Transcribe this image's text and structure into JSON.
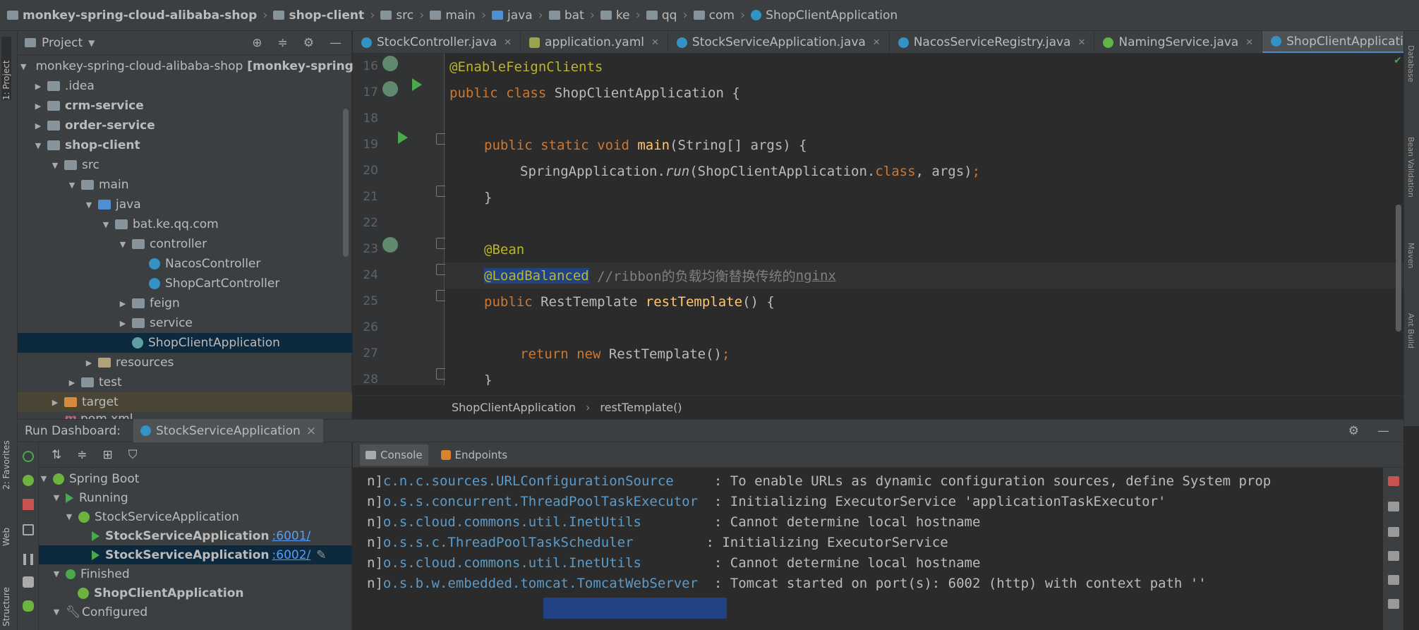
{
  "navbar": {
    "crumbs": [
      "monkey-spring-cloud-alibaba-shop",
      "shop-client",
      "src",
      "main",
      "java",
      "bat",
      "ke",
      "qq",
      "com",
      "ShopClientApplication"
    ]
  },
  "leftstrip": {
    "project": "1: Project",
    "favorites": "2: Favorites",
    "web": "Web",
    "structure": "Z: Structure"
  },
  "rightstrip": {
    "database": "Database",
    "bean": "Bean Validation",
    "maven": "Maven",
    "ant": "Ant Build"
  },
  "project": {
    "title": "Project",
    "tools": [
      "⊕",
      "≑",
      "⚙",
      "—"
    ],
    "tree": [
      {
        "label": "monkey-spring-cloud-alibaba-shop",
        "hint": "[monkey-spring-cl",
        "bold": false
      },
      {
        "label": ".idea"
      },
      {
        "label": "crm-service"
      },
      {
        "label": "order-service"
      },
      {
        "label": "shop-client"
      },
      {
        "label": "src"
      },
      {
        "label": "main"
      },
      {
        "label": "java"
      },
      {
        "label": "bat.ke.qq.com"
      },
      {
        "label": "controller"
      },
      {
        "label": "NacosController"
      },
      {
        "label": "ShopCartController"
      },
      {
        "label": "feign"
      },
      {
        "label": "service"
      },
      {
        "label": "ShopClientApplication"
      },
      {
        "label": "resources"
      },
      {
        "label": "test"
      },
      {
        "label": "target"
      },
      {
        "label": "pom.xml"
      }
    ]
  },
  "tabs": [
    {
      "label": "StockController.java",
      "icon": "class-icon"
    },
    {
      "label": "application.yaml",
      "icon": "yaml-icon"
    },
    {
      "label": "StockServiceApplication.java",
      "icon": "class-icon"
    },
    {
      "label": "NacosServiceRegistry.java",
      "icon": "class-icon"
    },
    {
      "label": "NamingService.java",
      "icon": "interface-icon"
    },
    {
      "label": "ShopClientApplication.java",
      "icon": "class-icon"
    }
  ],
  "tabs_more": "▾",
  "editor": {
    "lines": [
      "16",
      "17",
      "18",
      "19",
      "20",
      "21",
      "22",
      "23",
      "24",
      "25",
      "26",
      "27",
      "28"
    ],
    "l16_ann": "@EnableFeignClients",
    "l17_kw": "public class ",
    "l17_name": "ShopClientApplication {",
    "l19_kw": "public static void ",
    "l19_fn": "main",
    "l19_rest": "(String[] args) {",
    "l20_a": "SpringApplication.",
    "l20_b": "run",
    "l20_c": "(ShopClientApplication.",
    "l20_d": "class",
    "l20_e": ", args)",
    "l20_f": ";",
    "l21": "}",
    "l23_ann": "@Bean",
    "l24_ann": "@LoadBalanced",
    "l24_cmt": " //ribbon的负载均衡替换传统的",
    "l24_cmt2": "nginx",
    "l25_kw": "public ",
    "l25_type": "RestTemplate ",
    "l25_fn": "restTemplate",
    "l25_rest": "() {",
    "l27_kw": "return new ",
    "l27_rest": "RestTemplate()",
    "l27_semi": ";",
    "l28": "}"
  },
  "editor_breadcrumb": [
    "ShopClientApplication",
    "›",
    "restTemplate()"
  ],
  "run": {
    "title": "Run Dashboard:",
    "tab": "StockServiceApplication",
    "tab_close": "×",
    "tools": [
      "⚙",
      "—"
    ],
    "toolbar": [
      "⇅",
      "≑",
      "⊞",
      "⛉"
    ],
    "tree": [
      {
        "label": "Spring Boot"
      },
      {
        "label": "Running"
      },
      {
        "label": "StockServiceApplication"
      },
      {
        "label": "StockServiceApplication",
        "port": ":6001/"
      },
      {
        "label": "StockServiceApplication",
        "port": ":6002/"
      },
      {
        "label": "Finished"
      },
      {
        "label": "ShopClientApplication"
      },
      {
        "label": "Configured"
      }
    ]
  },
  "console": {
    "tab_console": "Console",
    "tab_endpoints": "Endpoints",
    "rows": [
      {
        "prefix": "n]",
        "logger_a": "c.n.c.sources.",
        "logger_b": "URLConfigurationSource",
        "msg": "     : To enable URLs as dynamic configuration sources, define System prop"
      },
      {
        "prefix": "n]",
        "logger_a": "o.s.s.concurrent.",
        "logger_b": "ThreadPoolTaskExecutor",
        "msg": "  : Initializing ExecutorService 'applicationTaskExecutor'"
      },
      {
        "prefix": "n]",
        "logger_a": "o.s.cloud.commons.util.",
        "logger_b": "InetUtils",
        "msg": "         : Cannot determine local hostname"
      },
      {
        "prefix": "n]",
        "logger_a": "o.s.s.c.",
        "logger_b": "ThreadPoolTaskScheduler",
        "msg": "         : Initializing ExecutorService"
      },
      {
        "prefix": "n]",
        "logger_a": "o.s.cloud.commons.util.",
        "logger_b": "InetUtils",
        "msg": "         : Cannot determine local hostname"
      },
      {
        "prefix": "n]",
        "logger_a": "o.s.b.w.embedded.tomcat.",
        "logger_b": "TomcatWebServer",
        "msg": "  : Tomcat started on port(s): 6002 (http) with context path ''"
      }
    ]
  }
}
